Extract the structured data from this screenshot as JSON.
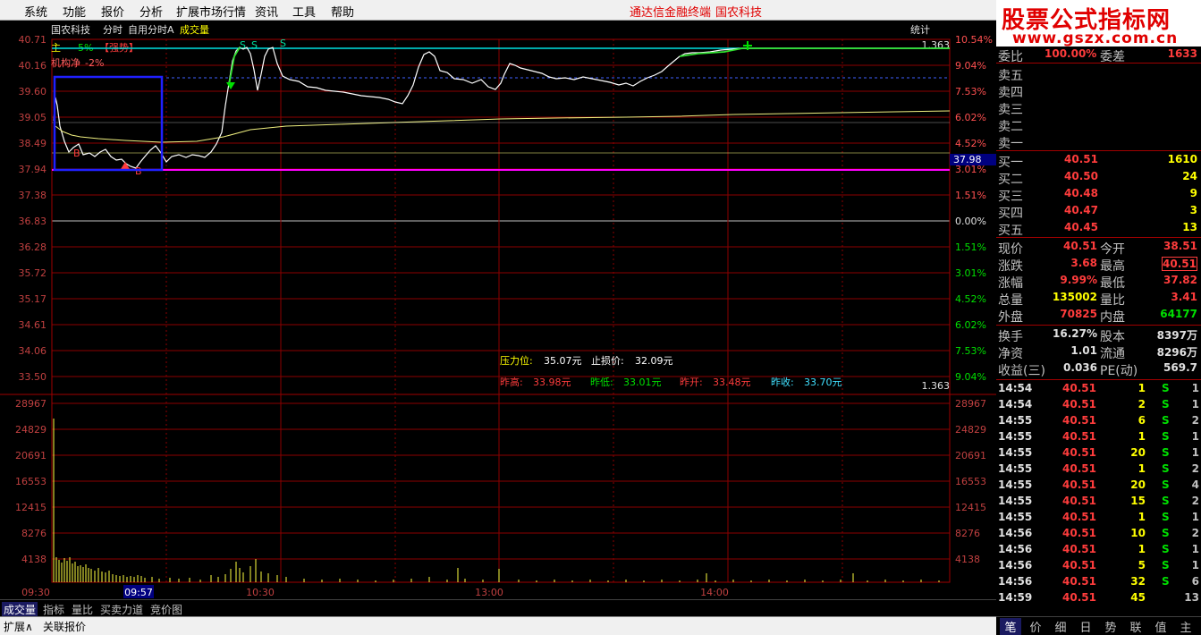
{
  "menu": [
    "系统",
    "功能",
    "报价",
    "分析",
    "扩展市场行情",
    "资讯",
    "工具",
    "帮助"
  ],
  "brand": {
    "terminal": "通达信金融终端",
    "stock": "国农科技"
  },
  "logo": {
    "line1": "股票公式指标网",
    "line2": "www.gszx.com.cn"
  },
  "header": {
    "stock": "国农科技",
    "mode": "分时",
    "indicator": "自用分时A",
    "volume_label": "成交量",
    "stats": "统计",
    "top_right_value": "1.363",
    "mid_right_value": "1.363"
  },
  "overlay": {
    "main_label": "主 ",
    "main_pct": "-5%",
    "flag": "【强势】",
    "inst_label": "机构净",
    "inst_pct": "-2%"
  },
  "price_axis": {
    "left": [
      "40.71",
      "40.16",
      "39.60",
      "39.05",
      "38.49",
      "37.94",
      "37.38",
      "36.83",
      "36.28",
      "35.72",
      "35.17",
      "34.61",
      "34.06",
      "33.50"
    ],
    "right": [
      "10.54%",
      "9.04%",
      "7.53%",
      "6.02%",
      "4.52%",
      "3.01%",
      "1.51%",
      "0.00%",
      "1.51%",
      "3.01%",
      "4.52%",
      "6.02%",
      "7.53%",
      "9.04%"
    ],
    "current_marker": "37.98"
  },
  "volume_axis": [
    "28967",
    "24829",
    "20691",
    "16553",
    "12415",
    "8276",
    "4138"
  ],
  "time_axis": [
    "09:30",
    "10:30",
    "13:00",
    "14:00"
  ],
  "time_cursor": "09:57",
  "info": {
    "pressure_label": "压力位:",
    "pressure": "35.07元",
    "stoploss_label": "止损价:",
    "stoploss": "32.09元",
    "prev_high_label": "昨高:",
    "prev_high": "33.98元",
    "prev_low_label": "昨低:",
    "prev_low": "33.01元",
    "prev_open_label": "昨开:",
    "prev_open": "33.48元",
    "prev_close_label": "昨收:",
    "prev_close": "33.70元"
  },
  "markers": {
    "sell": "S",
    "buy": "B"
  },
  "quote": {
    "ratio_label": "委比",
    "ratio": "100.00%",
    "diff_label": "委差",
    "diff": "1633",
    "asks": [
      {
        "label": "卖五",
        "price": "",
        "vol": ""
      },
      {
        "label": "卖四",
        "price": "",
        "vol": ""
      },
      {
        "label": "卖三",
        "price": "",
        "vol": ""
      },
      {
        "label": "卖二",
        "price": "",
        "vol": ""
      },
      {
        "label": "卖一",
        "price": "",
        "vol": ""
      }
    ],
    "bids": [
      {
        "label": "买一",
        "price": "40.51",
        "vol": "1610"
      },
      {
        "label": "买二",
        "price": "40.50",
        "vol": "24"
      },
      {
        "label": "买三",
        "price": "40.48",
        "vol": "9"
      },
      {
        "label": "买四",
        "price": "40.47",
        "vol": "3"
      },
      {
        "label": "买五",
        "price": "40.45",
        "vol": "13"
      }
    ],
    "stats": [
      {
        "l1": "现价",
        "v1": "40.51",
        "l2": "今开",
        "v2": "38.51"
      },
      {
        "l1": "涨跌",
        "v1": "3.68",
        "l2": "最高",
        "v2": "40.51"
      },
      {
        "l1": "涨幅",
        "v1": "9.99%",
        "l2": "最低",
        "v2": "37.82"
      },
      {
        "l1": "总量",
        "v1": "135002",
        "l2": "量比",
        "v2": "3.41"
      },
      {
        "l1": "外盘",
        "v1": "70825",
        "l2": "内盘",
        "v2": "64177"
      }
    ],
    "stats2": [
      {
        "l1": "换手",
        "v1": "16.27%",
        "l2": "股本",
        "v2": "8397万"
      },
      {
        "l1": "净资",
        "v1": "1.01",
        "l2": "流通",
        "v2": "8296万"
      },
      {
        "l1": "收益(三)",
        "v1": "0.036",
        "l2": "PE(动)",
        "v2": "569.7"
      }
    ]
  },
  "ticks": [
    {
      "t": "14:54",
      "p": "40.51",
      "v": "1",
      "d": "S",
      "n": "1"
    },
    {
      "t": "14:54",
      "p": "40.51",
      "v": "2",
      "d": "S",
      "n": "1"
    },
    {
      "t": "14:55",
      "p": "40.51",
      "v": "6",
      "d": "S",
      "n": "2"
    },
    {
      "t": "14:55",
      "p": "40.51",
      "v": "1",
      "d": "S",
      "n": "1"
    },
    {
      "t": "14:55",
      "p": "40.51",
      "v": "20",
      "d": "S",
      "n": "1"
    },
    {
      "t": "14:55",
      "p": "40.51",
      "v": "1",
      "d": "S",
      "n": "2"
    },
    {
      "t": "14:55",
      "p": "40.51",
      "v": "20",
      "d": "S",
      "n": "4"
    },
    {
      "t": "14:55",
      "p": "40.51",
      "v": "15",
      "d": "S",
      "n": "2"
    },
    {
      "t": "14:55",
      "p": "40.51",
      "v": "1",
      "d": "S",
      "n": "1"
    },
    {
      "t": "14:56",
      "p": "40.51",
      "v": "10",
      "d": "S",
      "n": "2"
    },
    {
      "t": "14:56",
      "p": "40.51",
      "v": "1",
      "d": "S",
      "n": "1"
    },
    {
      "t": "14:56",
      "p": "40.51",
      "v": "5",
      "d": "S",
      "n": "1"
    },
    {
      "t": "14:56",
      "p": "40.51",
      "v": "32",
      "d": "S",
      "n": "6"
    },
    {
      "t": "14:59",
      "p": "40.51",
      "v": "45",
      "d": "",
      "n": "13"
    }
  ],
  "bottom_tabs": [
    "成交量",
    "指标",
    "量比",
    "买卖力道",
    "竞价图"
  ],
  "bottom_tabs2": [
    "扩展∧",
    "关联报价"
  ],
  "right_tabs": [
    "笔",
    "价",
    "细",
    "日",
    "势",
    "联",
    "值",
    "主"
  ],
  "colors": {
    "up": "#ff3c3c",
    "down": "#00e000",
    "price_line": "#ffffff",
    "avg_line": "#f0f080",
    "grid": "#8b0000",
    "axis_text": "#c04040",
    "zero_line": "#ffffff",
    "box": "#2020ff",
    "magenta": "#ff00ff",
    "cyan": "#00ffff",
    "yellow": "#ffff00"
  }
}
